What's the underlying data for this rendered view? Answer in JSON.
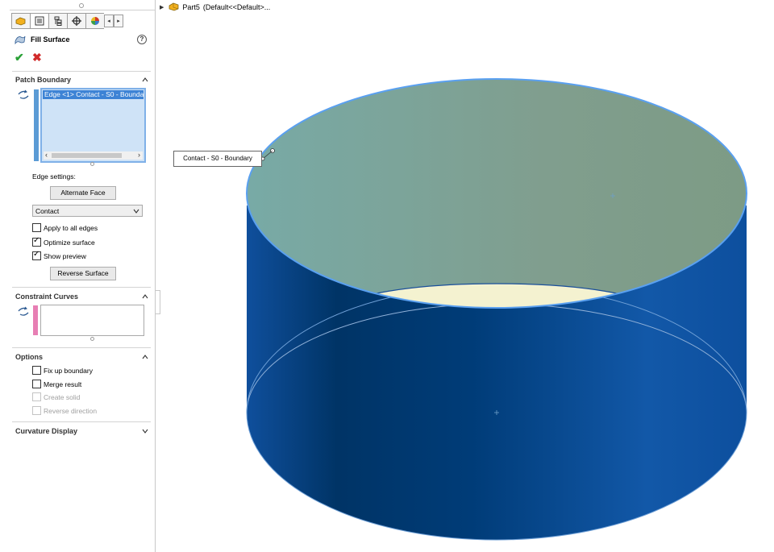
{
  "tree": {
    "part_name": "Part5",
    "config": "(Default<<Default>..."
  },
  "feature": {
    "title": "Fill Surface",
    "help_glyph": "?",
    "ok_glyph": "✔",
    "cancel_glyph": "✖"
  },
  "patch_boundary": {
    "header": "Patch Boundary",
    "selected_edge": "Edge <1> Contact - S0 - Boundary",
    "edge_settings_label": "Edge settings:",
    "alternate_face_button": "Alternate Face",
    "condition_value": "Contact",
    "apply_all_label": "Apply to all edges",
    "apply_all_checked": false,
    "optimize_label": "Optimize surface",
    "optimize_checked": true,
    "show_preview_label": "Show preview",
    "show_preview_checked": true,
    "reverse_surface_button": "Reverse Surface"
  },
  "constraint_curves": {
    "header": "Constraint Curves"
  },
  "options": {
    "header": "Options",
    "fix_up_label": "Fix up boundary",
    "fix_up_checked": false,
    "merge_label": "Merge result",
    "merge_checked": false,
    "create_solid_label": "Create solid",
    "reverse_dir_label": "Reverse direction"
  },
  "curvature_display": {
    "header": "Curvature Display"
  },
  "viewport": {
    "edge_callout": "Contact - S0 - Boundary"
  },
  "colors": {
    "accent": "#3d83d5",
    "boundary_bar": "#5b9bd5",
    "constraint_bar": "#e77fb4",
    "cylinder_dark": "#00305f",
    "cylinder_light": "#1156a6",
    "fill_surface": "#7fa89a",
    "inner_bottom": "#f4f2d0"
  }
}
